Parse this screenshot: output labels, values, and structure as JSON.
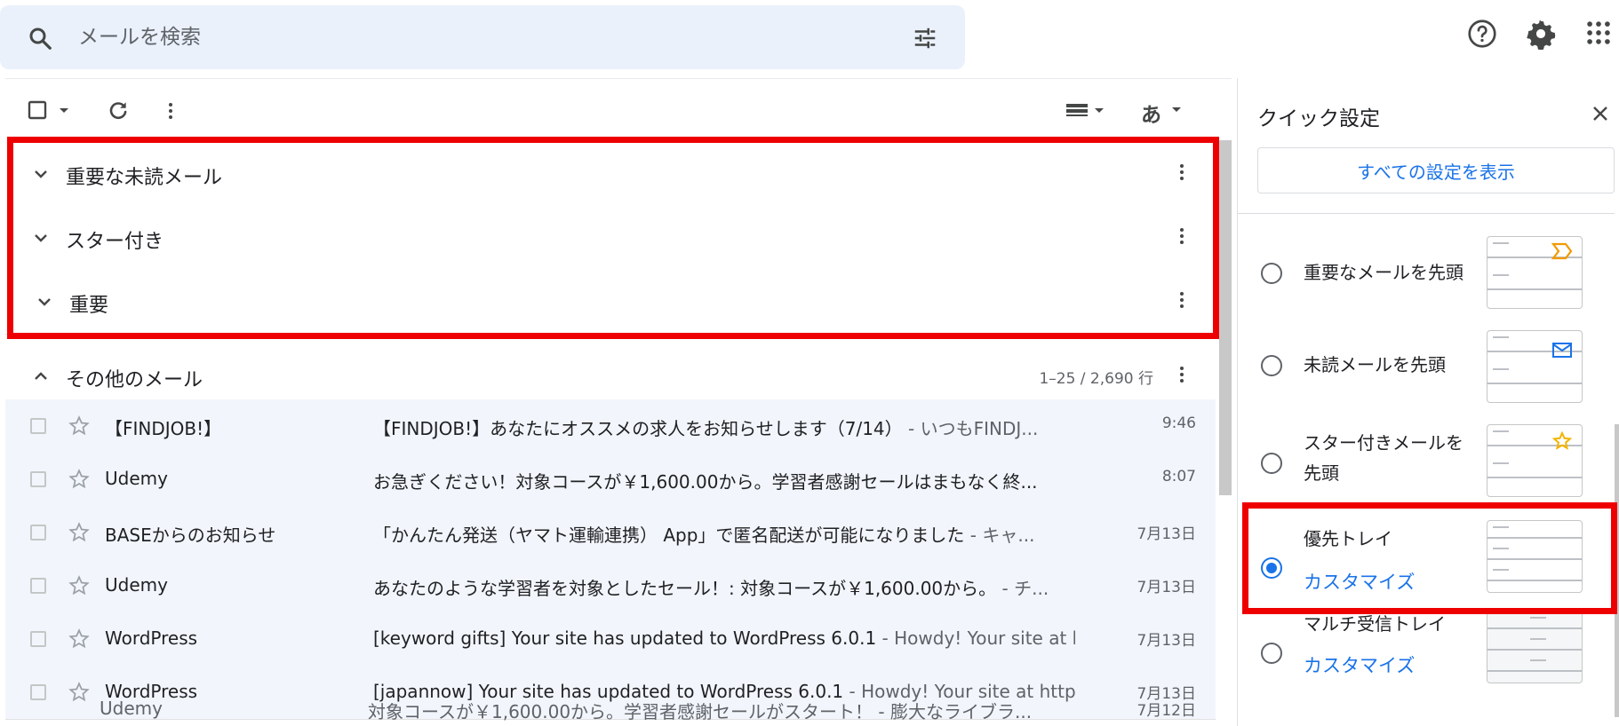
{
  "search": {
    "placeholder": "メールを検索",
    "icon": "search-icon",
    "filter_icon": "tune-icon"
  },
  "header_icons": [
    "help-icon",
    "gear-icon",
    "apps-icon"
  ],
  "toolbar": {
    "input_tool_label": "あ"
  },
  "sections": [
    {
      "label": "重要な未読メール",
      "expanded": false
    },
    {
      "label": "スター付き",
      "expanded": false
    },
    {
      "label": "重要",
      "expanded": false
    },
    {
      "label": "その他のメール",
      "expanded": true,
      "count": "1–25 / 2,690 行"
    }
  ],
  "emails": [
    {
      "sender": "【FINDJOB!】",
      "subject": "【FINDJOB!】あなたにオススメの求人をお知らせします（7/14）",
      "snippet": " - いつもFINDJ...",
      "time": "9:46"
    },
    {
      "sender": "Udemy",
      "subject": "お急ぎください！対象コースが￥1,600.00から。学習者感謝セールはまもなく終...",
      "snippet": "",
      "time": "8:07"
    },
    {
      "sender": "BASEからのお知らせ",
      "subject": "「かんたん発送（ヤマト運輸連携） App」で匿名配送が可能になりました",
      "snippet": " - キャ...",
      "time": "7月13日"
    },
    {
      "sender": "Udemy",
      "subject": "あなたのような学習者を対象としたセール！: 対象コースが￥1,600.00から。",
      "snippet": " - チ...",
      "time": "7月13日"
    },
    {
      "sender": "WordPress",
      "subject": "[keyword gifts] Your site has updated to WordPress 6.0.1",
      "snippet": " - Howdy! Your site at h...",
      "time": "7月13日"
    },
    {
      "sender": "WordPress",
      "subject": "[japannow] Your site has updated to WordPress 6.0.1",
      "snippet": " - Howdy! Your site at http:/...",
      "time": "7月13日"
    }
  ],
  "cut_row": {
    "sender": "Udemy",
    "subject": "対象コースが￥1,600.00から。学習者感謝セールがスタート！ - 膨大なライブラ...",
    "time": "7月12日"
  },
  "quick_settings": {
    "title": "クイック設定",
    "all_settings_button": "すべての設定を表示",
    "options": [
      {
        "label": "重要なメールを先頭",
        "selected": false,
        "thumb_icon": "important-marker-icon",
        "customize": ""
      },
      {
        "label": "未読メールを先頭",
        "selected": false,
        "thumb_icon": "envelope-icon",
        "customize": ""
      },
      {
        "label": "スター付きメールを先頭",
        "selected": false,
        "thumb_icon": "star-icon",
        "customize": ""
      },
      {
        "label": "優先トレイ",
        "selected": true,
        "thumb_icon": "",
        "customize": "カスタマイズ"
      },
      {
        "label": "マルチ受信トレイ",
        "selected": false,
        "thumb_icon": "",
        "customize": "カスタマイズ"
      }
    ]
  },
  "colors": {
    "highlight": "#ee0000",
    "accent": "#1a73e8",
    "important": "#f29900",
    "star": "#f4b400"
  }
}
